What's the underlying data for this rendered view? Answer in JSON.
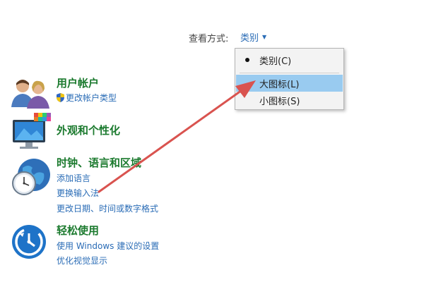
{
  "view_by": {
    "label": "查看方式:",
    "value": "类别"
  },
  "menu": {
    "items": [
      {
        "label": "类别(C)",
        "checked": true
      },
      {
        "label": "大图标(L)",
        "highlighted": true
      },
      {
        "label": "小图标(S)"
      }
    ]
  },
  "categories": [
    {
      "title": "用户帐户",
      "links": [
        "更改帐户类型"
      ],
      "icon": "users-icon"
    },
    {
      "title": "外观和个性化",
      "links": [],
      "icon": "monitor-palette-icon"
    },
    {
      "title": "时钟、语言和区域",
      "links": [
        "添加语言",
        "更换输入法",
        "更改日期、时间或数字格式"
      ],
      "icon": "clock-globe-icon"
    },
    {
      "title": "轻松使用",
      "links": [
        "使用 Windows 建议的设置",
        "优化视觉显示"
      ],
      "icon": "ease-of-access-icon"
    }
  ],
  "annotation": {
    "arrow_color": "#d9534f"
  },
  "colors": {
    "category_title": "#1b7a2e",
    "link": "#2a6cb6",
    "menu_highlight": "#99cbf0"
  }
}
